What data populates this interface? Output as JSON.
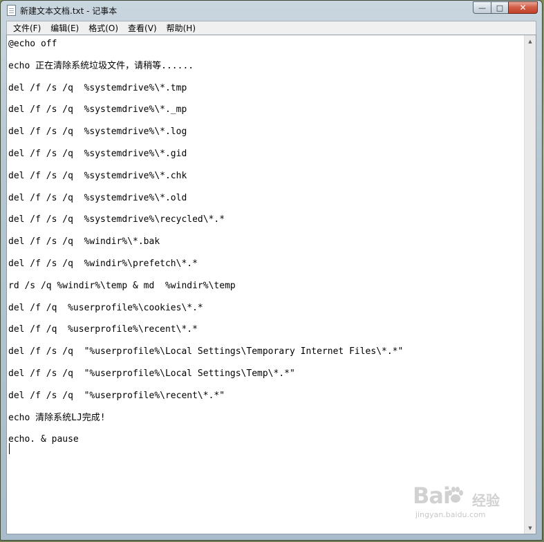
{
  "window": {
    "title": "新建文本文档.txt - 记事本",
    "controls": {
      "minimize": "—",
      "maximize": "□",
      "close": "✕"
    }
  },
  "menu": [
    {
      "label": "文件(F)"
    },
    {
      "label": "编辑(E)"
    },
    {
      "label": "格式(O)"
    },
    {
      "label": "查看(V)"
    },
    {
      "label": "帮助(H)"
    }
  ],
  "editor": {
    "lines": [
      "@echo off",
      "echo 正在清除系统垃圾文件，请稍等......",
      "del /f /s /q  %systemdrive%\\*.tmp",
      "del /f /s /q  %systemdrive%\\*._mp",
      "del /f /s /q  %systemdrive%\\*.log",
      "del /f /s /q  %systemdrive%\\*.gid",
      "del /f /s /q  %systemdrive%\\*.chk",
      "del /f /s /q  %systemdrive%\\*.old",
      "del /f /s /q  %systemdrive%\\recycled\\*.*",
      "del /f /s /q  %windir%\\*.bak",
      "del /f /s /q  %windir%\\prefetch\\*.*",
      "rd /s /q %windir%\\temp & md  %windir%\\temp",
      "del /f /q  %userprofile%\\cookies\\*.*",
      "del /f /q  %userprofile%\\recent\\*.*",
      "del /f /s /q  \"%userprofile%\\Local Settings\\Temporary Internet Files\\*.*\"",
      "del /f /s /q  \"%userprofile%\\Local Settings\\Temp\\*.*\"",
      "del /f /s /q  \"%userprofile%\\recent\\*.*\"",
      "echo 清除系统LJ完成!",
      "echo. & pause"
    ]
  },
  "scrollbar": {
    "up_arrow": "▲",
    "down_arrow": "▼"
  },
  "watermark": {
    "logo": "Bai",
    "logo_suffix": "经验",
    "url": "jingyan.baidu.com"
  }
}
